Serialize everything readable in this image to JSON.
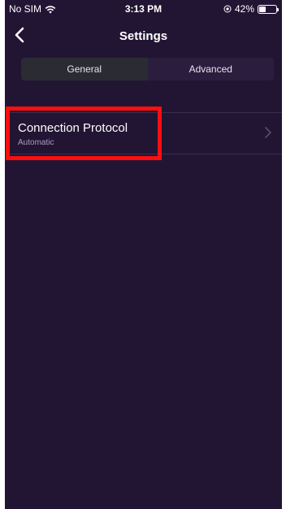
{
  "status_bar": {
    "carrier": "No SIM",
    "time": "3:13 PM",
    "battery_percent": "42%",
    "battery_level": 0.42,
    "icons": [
      "wifi-icon",
      "location-icon",
      "battery-charging-icon"
    ]
  },
  "nav": {
    "title": "Settings",
    "back_icon": "chevron-left-icon"
  },
  "segmented_control": {
    "tabs": [
      {
        "label": "General",
        "selected": false
      },
      {
        "label": "Advanced",
        "selected": true
      }
    ]
  },
  "settings": {
    "rows": [
      {
        "title": "Connection Protocol",
        "subtitle": "Automatic",
        "icon": "chevron-right-icon"
      }
    ]
  },
  "colors": {
    "background": "#221534",
    "highlight": "#ff0e0e",
    "text_primary": "#ffffff",
    "text_secondary": "#a89bbd"
  }
}
